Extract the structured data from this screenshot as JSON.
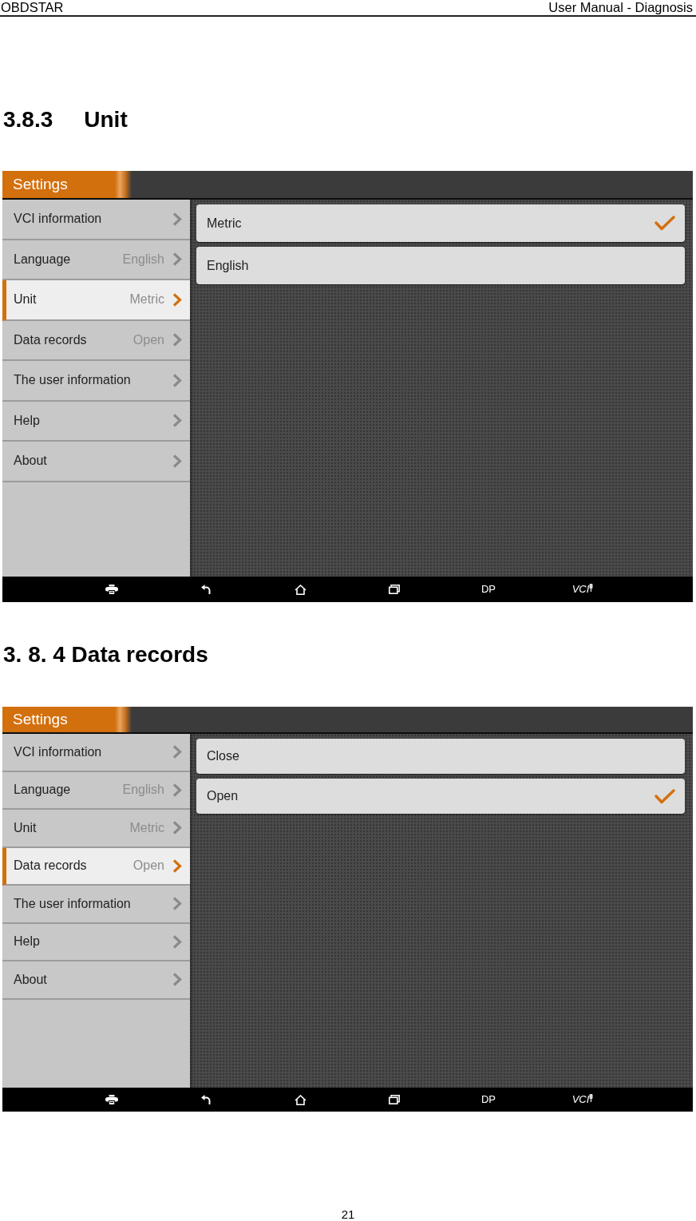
{
  "page_header": {
    "left": "OBDSTAR",
    "right": "User Manual - Diagnosis"
  },
  "sections": [
    {
      "heading": {
        "number": "3.8.3",
        "title": "Unit"
      },
      "screen": {
        "title": "Settings",
        "menu": [
          {
            "label": "VCI information",
            "selected": false
          },
          {
            "label": "Language",
            "value": "English",
            "selected": false
          },
          {
            "label": "Unit",
            "value": "Metric",
            "selected": true
          },
          {
            "label": "Data records",
            "value": "Open",
            "selected": false
          },
          {
            "label": "The user information",
            "selected": false
          },
          {
            "label": "Help",
            "selected": false
          },
          {
            "label": "About",
            "selected": false
          }
        ],
        "options": [
          {
            "label": "Metric",
            "selected": true
          },
          {
            "label": "English",
            "selected": false
          }
        ],
        "nav_buttons": [
          {
            "kind": "text",
            "label": "DP"
          },
          {
            "kind": "connection",
            "label": "VCI"
          }
        ]
      }
    },
    {
      "heading": {
        "title": "3. 8. 4 Data records"
      },
      "screen": {
        "title": "Settings",
        "menu": [
          {
            "label": "VCI information",
            "selected": false
          },
          {
            "label": "Language",
            "value": "English",
            "selected": false
          },
          {
            "label": "Unit",
            "value": "Metric",
            "selected": false
          },
          {
            "label": "Data records",
            "value": "Open",
            "selected": true
          },
          {
            "label": "The user information",
            "selected": false
          },
          {
            "label": "Help",
            "selected": false
          },
          {
            "label": "About",
            "selected": false
          }
        ],
        "options": [
          {
            "label": "Close",
            "selected": false
          },
          {
            "label": "Open",
            "selected": true
          }
        ],
        "nav_buttons": [
          {
            "kind": "text",
            "label": "DP"
          },
          {
            "kind": "connection",
            "label": "VCI"
          }
        ]
      }
    }
  ],
  "page_number": "21"
}
